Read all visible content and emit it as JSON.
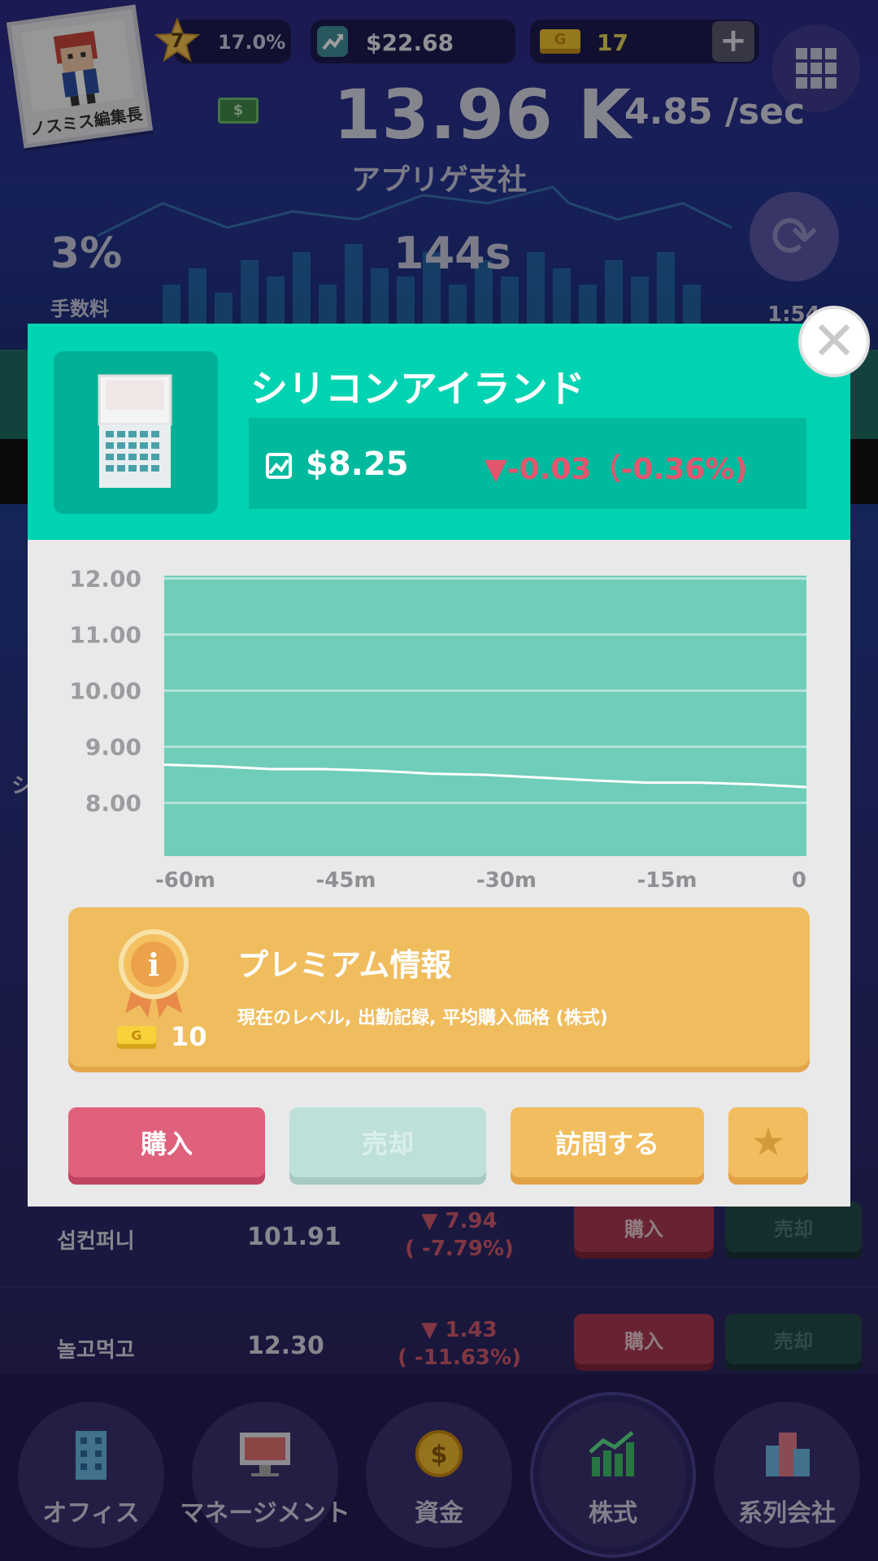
{
  "header": {
    "avatar_label": "ノスミス編集長",
    "level": "7",
    "level_progress": "17.0%",
    "cash": "$22.68",
    "gold": "17",
    "plus_label": "+",
    "total_money": "13.96 K",
    "income_rate": "4.85 /sec",
    "company_name": "アプリゲ支社",
    "fee_value": "3%",
    "fee_label": "手数料",
    "cycle_seconds": "144s",
    "timer": "1:54"
  },
  "background_list": {
    "partial_label": "シ",
    "rows": [
      {
        "name": "섭컨퍼니",
        "price": "101.91",
        "change": "▼ 7.94",
        "change_pct": "( -7.79%)",
        "buy": "購入",
        "sell": "売却"
      },
      {
        "name": "놀고먹고",
        "price": "12.30",
        "change": "▼ 1.43",
        "change_pct": "( -11.63%)",
        "buy": "購入",
        "sell": "売却"
      }
    ]
  },
  "modal": {
    "title": "シリコンアイランド",
    "price": "$8.25",
    "change": "▼-0.03（-0.36%)",
    "close_label": "✕",
    "premium": {
      "title": "プレミアム情報",
      "subtitle": "現在のレベル, 出勤記録, 平均購入価格 (株式)",
      "cost": "10",
      "gold_icon_letter": "G"
    },
    "buttons": {
      "buy": "購入",
      "sell": "売却",
      "visit": "訪問する",
      "star": "★"
    }
  },
  "chart_data": {
    "type": "area",
    "x": [
      -60,
      -55,
      -50,
      -45,
      -40,
      -35,
      -30,
      -25,
      -20,
      -15,
      -10,
      -5,
      0
    ],
    "x_tick_labels": [
      "-60m",
      "-45m",
      "-30m",
      "-15m",
      "0"
    ],
    "x_tick_values": [
      -60,
      -45,
      -30,
      -15,
      0
    ],
    "y_tick_labels": [
      "12.00",
      "11.00",
      "10.00",
      "9.00",
      "8.00"
    ],
    "y_tick_values": [
      12,
      11,
      10,
      9,
      8
    ],
    "ylim": [
      7.05,
      12.05
    ],
    "xlim": [
      -60,
      0
    ],
    "values": [
      8.68,
      8.65,
      8.6,
      8.6,
      8.57,
      8.52,
      8.5,
      8.45,
      8.4,
      8.36,
      8.36,
      8.33,
      8.28
    ],
    "grid": true,
    "colors": {
      "fill": "#70cdb9",
      "line": "#ffffff",
      "grid": "#b4e4da"
    }
  },
  "nav": {
    "items": [
      {
        "label": "オフィス"
      },
      {
        "label": "マネージメント"
      },
      {
        "label": "資金"
      },
      {
        "label": "株式"
      },
      {
        "label": "系列会社"
      }
    ]
  },
  "colors": {
    "accent": "#00d3b1",
    "buy": "#e0617b",
    "premium": "#f0bd5e",
    "negative": "#e4566e"
  }
}
